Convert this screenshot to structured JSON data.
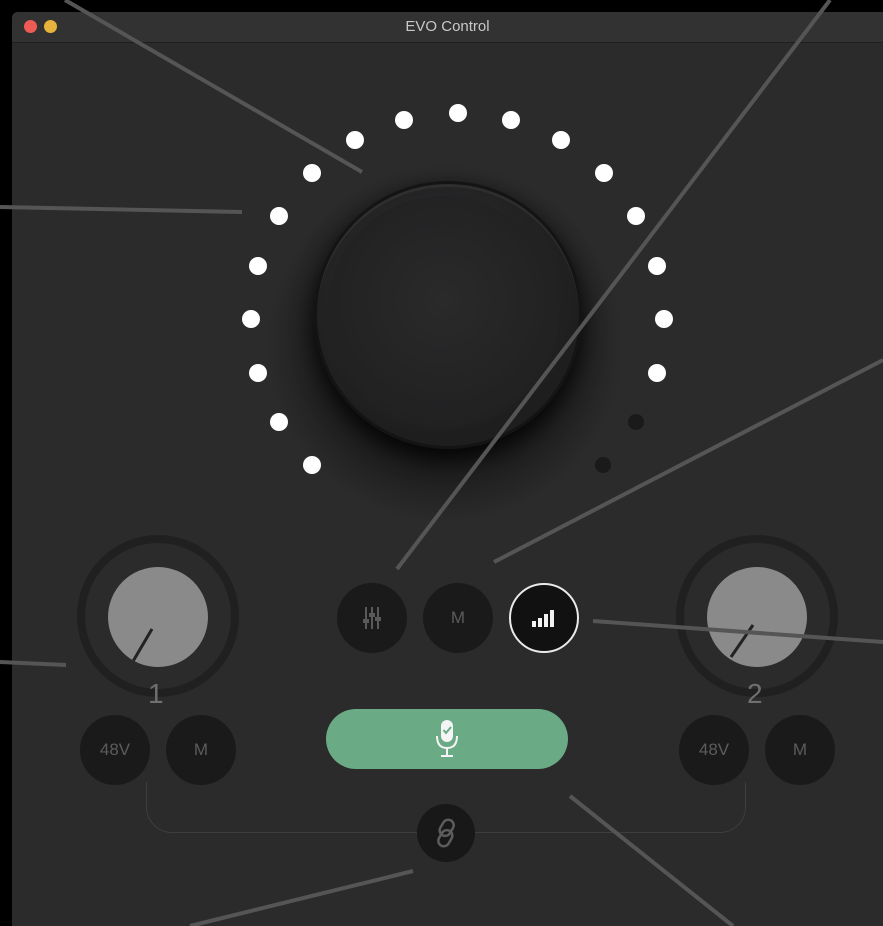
{
  "window": {
    "title": "EVO Control"
  },
  "monitor": {
    "buttons": [
      {
        "name": "mixer-button",
        "label": "",
        "icon": "mixer-sliders-icon"
      },
      {
        "name": "monitor-mute-button",
        "label": "M"
      },
      {
        "name": "meter-button",
        "label": "",
        "icon": "level-bars-icon",
        "selected": true
      }
    ],
    "level_leds_lit": 18,
    "level_leds_total": 20
  },
  "channels": [
    {
      "number": "1",
      "phantom_label": "48V",
      "mute_label": "M",
      "gain_level": 0.55
    },
    {
      "number": "2",
      "phantom_label": "48V",
      "mute_label": "M",
      "gain_level": 0.6
    }
  ],
  "smartgain": {
    "icon": "microphone-check-icon",
    "color": "#6aaa85"
  },
  "link": {
    "icon": "link-icon"
  },
  "colors": {
    "background": "#2b2b2c",
    "accent": "#6aaa85",
    "led_on": "#ffffff"
  }
}
